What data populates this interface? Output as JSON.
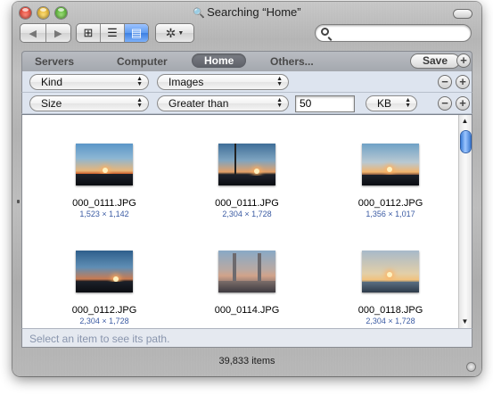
{
  "window": {
    "title": "Searching “Home”",
    "title_icon": "magnifier-icon"
  },
  "toolbar": {
    "back_label": "◀",
    "forward_label": "▶",
    "views": [
      {
        "name": "icon-view",
        "glyph": "⊞",
        "selected": false
      },
      {
        "name": "list-view",
        "glyph": "☰",
        "selected": false
      },
      {
        "name": "column-view",
        "glyph": "▤",
        "selected": true
      }
    ],
    "action_glyph": "✲",
    "action_caret": "▼",
    "search": {
      "value": "",
      "placeholder": ""
    }
  },
  "scope": {
    "items": [
      "Servers",
      "Computer",
      "Home",
      "Others..."
    ],
    "selected": "Home",
    "save_label": "Save",
    "add_label": "+"
  },
  "criteria": [
    {
      "attribute": "Kind",
      "value": "Images",
      "remove_label": "−",
      "add_label": "+"
    },
    {
      "attribute": "Size",
      "operator": "Greater than",
      "amount": "50",
      "unit": "KB",
      "remove_label": "−",
      "add_label": "+"
    }
  ],
  "results": [
    {
      "name": "000_0111.JPG",
      "dims": "1,523 × 1,142"
    },
    {
      "name": "000_0111.JPG",
      "dims": "2,304 × 1,728"
    },
    {
      "name": "000_0112.JPG",
      "dims": "1,356 × 1,017"
    },
    {
      "name": "000_0112.JPG",
      "dims": "2,304 × 1,728"
    },
    {
      "name": "000_0114.JPG",
      "dims": ""
    },
    {
      "name": "000_0118.JPG",
      "dims": "2,304 × 1,728"
    }
  ],
  "scrollbar": {
    "up": "▲",
    "down": "▼"
  },
  "pathbar": {
    "text": "Select an item to see its path."
  },
  "status": {
    "text": "39,833 items"
  },
  "colors": {
    "accent": "#3d7fe2",
    "criteria_bg": "#dde4ef",
    "dims_text": "#3b5ba3"
  }
}
